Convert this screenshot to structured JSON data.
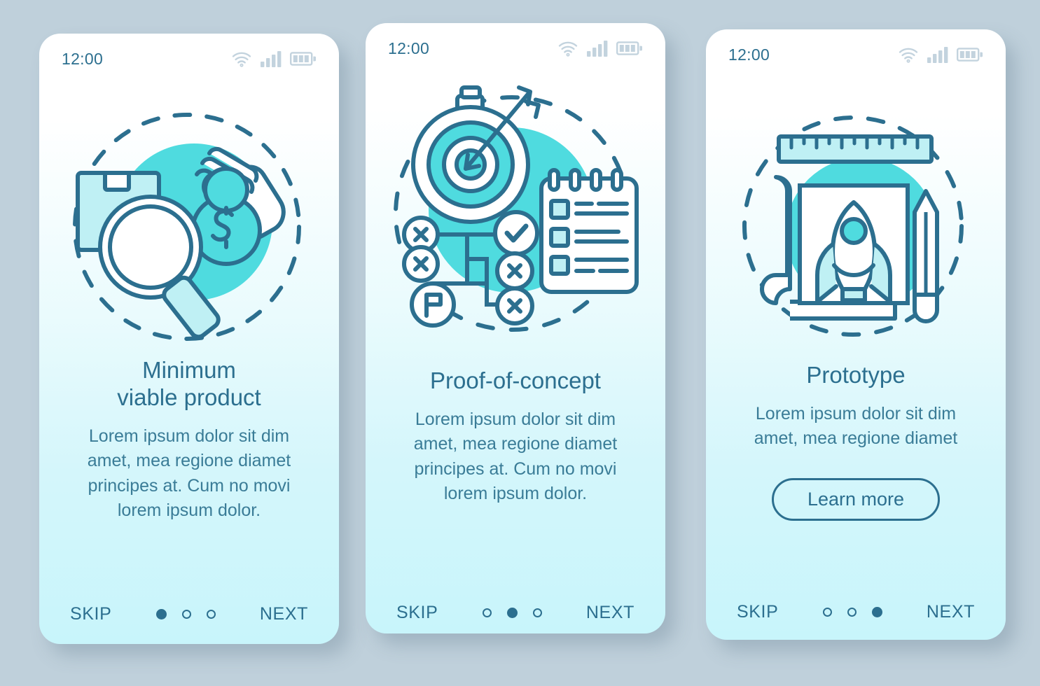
{
  "screen": {
    "background_color": "#bfd0db",
    "accent_teal": "#4fdbdf",
    "stroke_color": "#2c6f8f",
    "card_gradient_top": "#ffffff",
    "card_gradient_bottom": "#c8f5fb"
  },
  "cards": [
    {
      "id": "minimum-viable-product",
      "status": {
        "time": "12:00",
        "icons": [
          "wifi-icon",
          "signal-bars-icon",
          "battery-icon"
        ]
      },
      "illustration": {
        "name": "minimum-viable-product-illustration",
        "elements": [
          "package-box-icon",
          "magnifying-glass-icon",
          "hand-holding-coin-icon",
          "dollar-sign-icon",
          "dashed-circle",
          "teal-blob"
        ]
      },
      "title": "Minimum\nviable product",
      "description": "Lorem ipsum dolor sit dim\namet, mea regione diamet\nprincipes at. Cum no movi\nlorem ipsum dolor.",
      "learn_more": null,
      "nav": {
        "skip_label": "SKIP",
        "next_label": "NEXT",
        "dot_count": 3,
        "active_dot": 0
      }
    },
    {
      "id": "proof-of-concept",
      "status": {
        "time": "12:00",
        "icons": [
          "wifi-icon",
          "signal-bars-icon",
          "battery-icon"
        ]
      },
      "illustration": {
        "name": "proof-of-concept-illustration",
        "elements": [
          "stopwatch-target-icon",
          "arrow-icon",
          "clipboard-checklist-icon",
          "flowchart-icon",
          "x-mark-icon",
          "check-mark-icon",
          "flag-icon",
          "dashed-circle",
          "teal-blob"
        ]
      },
      "title": "Proof-of-concept",
      "description": "Lorem ipsum dolor sit dim\namet, mea regione diamet\nprincipes at. Cum no movi\nlorem ipsum dolor.",
      "learn_more": null,
      "nav": {
        "skip_label": "SKIP",
        "next_label": "NEXT",
        "dot_count": 3,
        "active_dot": 1
      }
    },
    {
      "id": "prototype",
      "status": {
        "time": "12:00",
        "icons": [
          "wifi-icon",
          "signal-bars-icon",
          "battery-icon"
        ]
      },
      "illustration": {
        "name": "prototype-illustration",
        "elements": [
          "ruler-icon",
          "blueprint-paper-icon",
          "rocket-icon",
          "pencil-icon",
          "dashed-circle",
          "teal-blob"
        ]
      },
      "title": "Prototype",
      "description": "Lorem ipsum dolor sit dim\namet, mea regione diamet",
      "learn_more": "Learn more",
      "nav": {
        "skip_label": "SKIP",
        "next_label": "NEXT",
        "dot_count": 3,
        "active_dot": 2
      }
    }
  ]
}
